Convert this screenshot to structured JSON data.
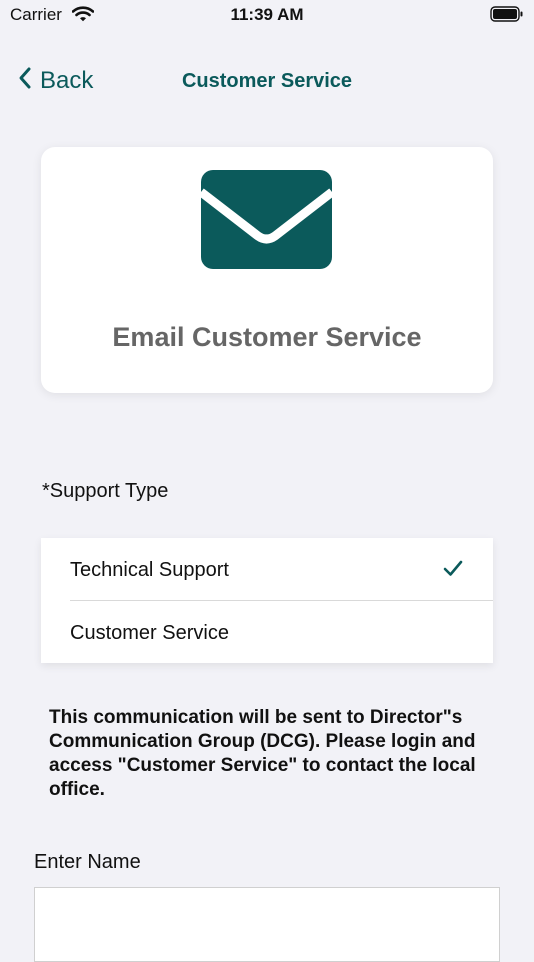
{
  "status_bar": {
    "carrier": "Carrier",
    "time": "11:39 AM"
  },
  "nav": {
    "back_label": "Back",
    "title": "Customer Service"
  },
  "card": {
    "label": "Email Customer Service"
  },
  "support": {
    "label": "*Support Type",
    "options": [
      {
        "label": "Technical Support",
        "selected": true
      },
      {
        "label": "Customer Service",
        "selected": false
      }
    ]
  },
  "notice": "This communication will be sent to Director\"s Communication Group (DCG). Please login and access \"Customer Service\" to contact the local office.",
  "name_field": {
    "label": "Enter Name",
    "value": ""
  },
  "colors": {
    "accent": "#0b5a5b",
    "background": "#f2f2f7"
  }
}
